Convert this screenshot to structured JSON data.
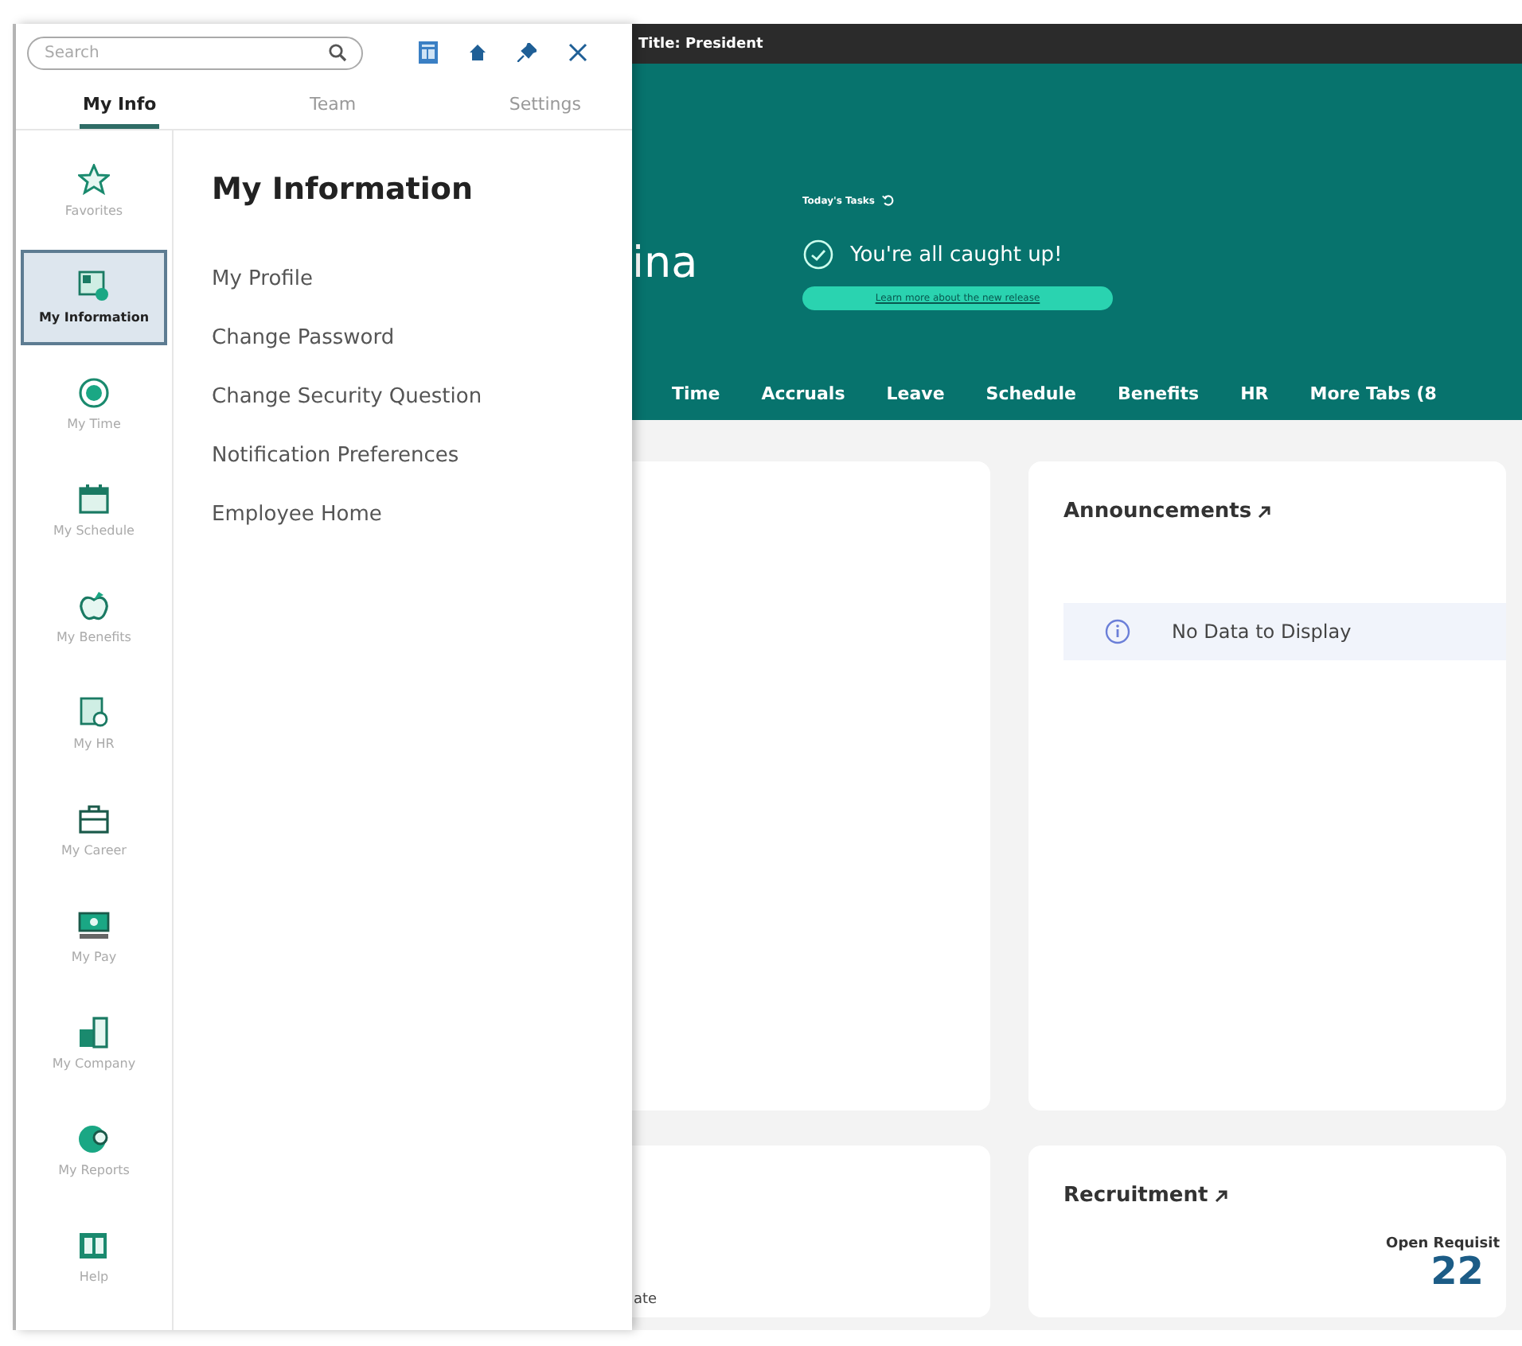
{
  "panel": {
    "search": {
      "placeholder": "Search"
    },
    "tabs": [
      {
        "label": "My Info",
        "selected": true
      },
      {
        "label": "Team",
        "selected": false
      },
      {
        "label": "Settings",
        "selected": false
      }
    ],
    "rail": [
      {
        "label": "Favorites",
        "selected": false
      },
      {
        "label": "My Information",
        "selected": true
      },
      {
        "label": "My Time",
        "selected": false
      },
      {
        "label": "My Schedule",
        "selected": false
      },
      {
        "label": "My Benefits",
        "selected": false
      },
      {
        "label": "My HR",
        "selected": false
      },
      {
        "label": "My Career",
        "selected": false
      },
      {
        "label": "My Pay",
        "selected": false
      },
      {
        "label": "My Company",
        "selected": false
      },
      {
        "label": "My Reports",
        "selected": false
      },
      {
        "label": "Help",
        "selected": false
      }
    ],
    "heading": "My Information",
    "links": [
      "My Profile",
      "Change Password",
      "Change Security Question",
      "Notification Preferences",
      "Employee Home"
    ]
  },
  "top_bar": {
    "title": "Title: President"
  },
  "header": {
    "name_fragment": "ina",
    "tasks_label": "Today's Tasks",
    "status": "You're all caught up!",
    "release_button": "Learn more about the new release",
    "tabs": [
      "Time",
      "Accruals",
      "Leave",
      "Schedule",
      "Benefits",
      "HR",
      "More Tabs (8"
    ]
  },
  "cards": {
    "left_bottom_text": "ate",
    "announcements": {
      "title": "Announcements",
      "empty": "No Data to Display"
    },
    "recruitment": {
      "title": "Recruitment",
      "label": "Open Requisit",
      "count": "22"
    }
  }
}
